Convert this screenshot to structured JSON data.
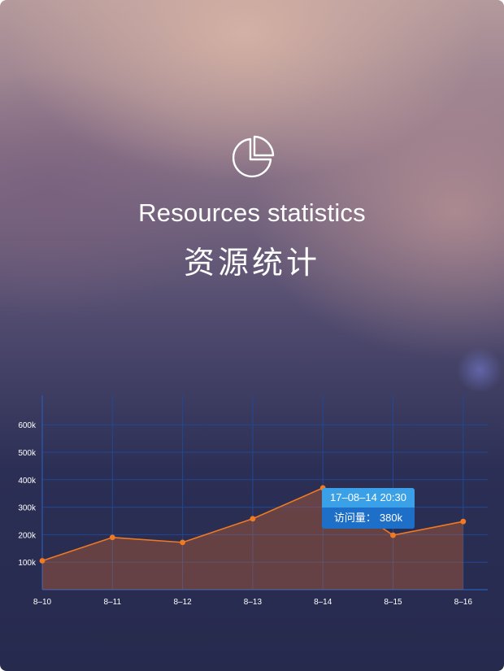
{
  "header": {
    "icon": "pie-chart-icon",
    "title_en": "Resources statistics",
    "title_cn": "资源统计"
  },
  "colors": {
    "line": "#f07a22",
    "area": "rgba(230,110,40,0.32)",
    "grid": "#1f4a9a",
    "tooltip_head": "#3aa0e8",
    "tooltip_body": "#1e6fc8"
  },
  "chart_data": {
    "type": "area",
    "categories": [
      "8–10",
      "8–11",
      "8–12",
      "8–13",
      "8–14",
      "8–15",
      "8–16"
    ],
    "series": [
      {
        "values": [
          105,
          190,
          172,
          258,
          370,
          198,
          248
        ]
      }
    ],
    "y_ticks": [
      "100k",
      "200k",
      "300k",
      "400k",
      "500k",
      "600k"
    ],
    "ylim": [
      0,
      600
    ],
    "grid": true,
    "tooltip": {
      "time": "17–08–14 20:30",
      "label": "访问量：",
      "value": "380k"
    }
  }
}
